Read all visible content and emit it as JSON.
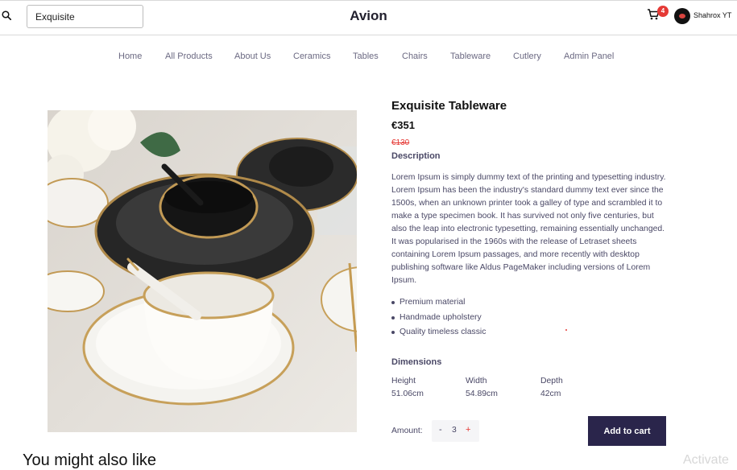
{
  "header": {
    "search_value": "Exquisite",
    "brand": "Avion",
    "cart_count": "4",
    "user_name": "Shahrox YT"
  },
  "nav": {
    "items": [
      {
        "label": "Home"
      },
      {
        "label": "All Products"
      },
      {
        "label": "About Us"
      },
      {
        "label": "Ceramics"
      },
      {
        "label": "Tables"
      },
      {
        "label": "Chairs"
      },
      {
        "label": "Tableware"
      },
      {
        "label": "Cutlery"
      },
      {
        "label": "Admin Panel"
      }
    ]
  },
  "product": {
    "title": "Exquisite Tableware",
    "price": "€351",
    "old_price": "€130",
    "description_label": "Description",
    "description": "Lorem Ipsum is simply dummy text of the printing and typesetting industry. Lorem Ipsum has been the industry's standard dummy text ever since the 1500s, when an unknown printer took a galley of type and scrambled it to make a type specimen book. It has survived not only five centuries, but also the leap into electronic typesetting, remaining essentially unchanged. It was popularised in the 1960s with the release of Letraset sheets containing Lorem Ipsum passages, and more recently with desktop publishing software like Aldus PageMaker including versions of Lorem Ipsum.",
    "features": [
      "Premium material",
      "Handmade upholstery",
      "Quality timeless classic"
    ],
    "dimensions_label": "Dimensions",
    "dimensions": {
      "height_label": "Height",
      "height": "51.06cm",
      "width_label": "Width",
      "width": "54.89cm",
      "depth_label": "Depth",
      "depth": "42cm"
    },
    "amount_label": "Amount:",
    "minus": "-",
    "quantity": "3",
    "plus": "+",
    "add_to_cart": "Add to cart"
  },
  "related": {
    "heading": "You might also like"
  },
  "watermark": "Activate"
}
